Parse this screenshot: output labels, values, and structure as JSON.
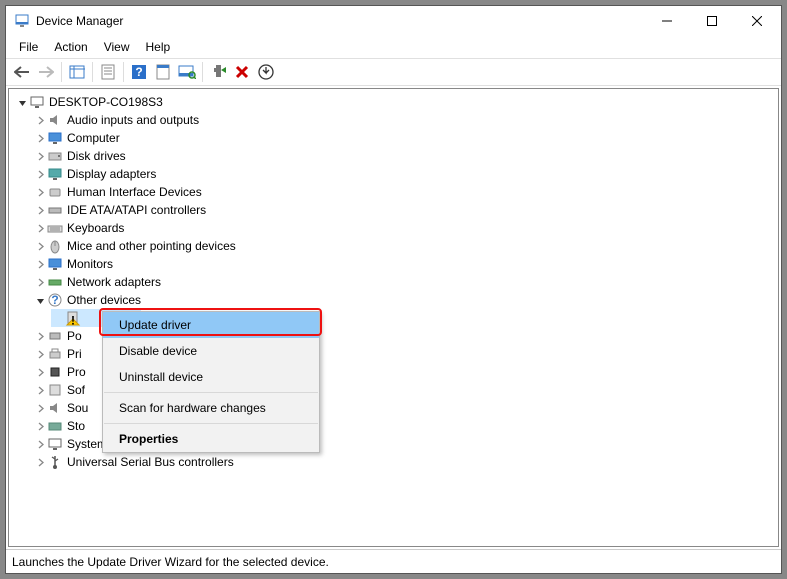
{
  "window": {
    "title": "Device Manager"
  },
  "winbtns": {
    "min": "min",
    "max": "max",
    "close": "close"
  },
  "menu": {
    "file": "File",
    "action": "Action",
    "view": "View",
    "help": "Help"
  },
  "toolbar_icons": {
    "back": "back-arrow",
    "fwd": "forward-arrow",
    "show_tree": "show-tree",
    "props": "properties-sheet",
    "help": "help",
    "sheet2": "sheet-alt",
    "monitor": "monitor-scan",
    "add": "add-hardware",
    "delete": "delete",
    "scan": "scan-changes"
  },
  "tree": {
    "root": "DESKTOP-CO198S3",
    "cats": [
      {
        "label": "Audio inputs and outputs",
        "icon": "speaker"
      },
      {
        "label": "Computer",
        "icon": "monitor"
      },
      {
        "label": "Disk drives",
        "icon": "drive"
      },
      {
        "label": "Display adapters",
        "icon": "display"
      },
      {
        "label": "Human Interface Devices",
        "icon": "hid"
      },
      {
        "label": "IDE ATA/ATAPI controllers",
        "icon": "ide"
      },
      {
        "label": "Keyboards",
        "icon": "keyboard"
      },
      {
        "label": "Mice and other pointing devices",
        "icon": "mouse"
      },
      {
        "label": "Monitors",
        "icon": "monitor"
      },
      {
        "label": "Network adapters",
        "icon": "network"
      },
      {
        "label": "Other devices",
        "icon": "other",
        "open": true
      },
      {
        "label": "Po",
        "icon": "port",
        "trunc": true
      },
      {
        "label": "Pri",
        "icon": "printer",
        "trunc": true
      },
      {
        "label": "Pro",
        "icon": "cpu",
        "trunc": true
      },
      {
        "label": "Sof",
        "icon": "soft",
        "trunc": true
      },
      {
        "label": "Sou",
        "icon": "speaker",
        "trunc": true
      },
      {
        "label": "Sto",
        "icon": "storage",
        "trunc": true
      },
      {
        "label": "System devices",
        "icon": "system"
      },
      {
        "label": "Universal Serial Bus controllers",
        "icon": "usb"
      }
    ],
    "unknown_child": {
      "label": "",
      "icon": "unknown-warn"
    }
  },
  "ctx": {
    "update": "Update driver",
    "disable": "Disable device",
    "uninstall": "Uninstall device",
    "scan": "Scan for hardware changes",
    "props": "Properties"
  },
  "statusbar": "Launches the Update Driver Wizard for the selected device."
}
